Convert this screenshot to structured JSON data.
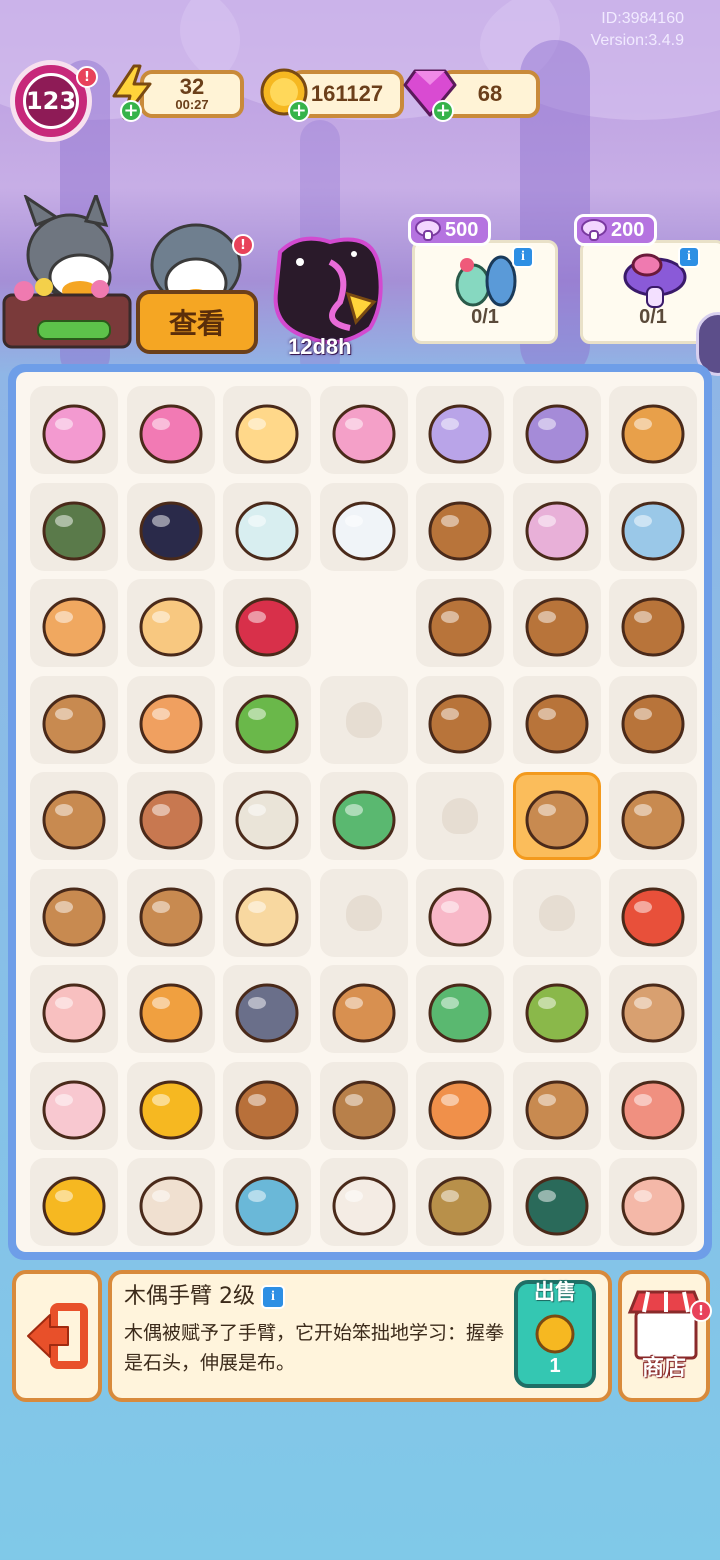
{
  "header": {
    "user_id": "ID:3984160",
    "version": "Version:3.4.9",
    "level": "123",
    "level_alert": "!"
  },
  "resources": {
    "energy": {
      "value": "32",
      "timer": "00:27",
      "icon": "lightning-icon"
    },
    "coins": {
      "value": "161127",
      "icon": "coin-icon"
    },
    "gems": {
      "value": "68",
      "icon": "gem-icon"
    }
  },
  "actions": {
    "view_button": "查看",
    "event_timer": "12d8h",
    "characters_alert": "!"
  },
  "quests": [
    {
      "cost": "500",
      "progress": "0/1",
      "icon": "mushroom-icon",
      "info": "i"
    },
    {
      "cost": "200",
      "progress": "0/1",
      "icon": "mushroom-icon",
      "info": "i"
    }
  ],
  "board": {
    "rows": [
      [
        "pink-cloud-sack",
        "duck-pink-dress",
        "duck-fairy",
        "duck-flower-fairy",
        "rose-plate",
        "duck-mirror",
        "duck-portrait"
      ],
      [
        "moss-scarecrow",
        "black-bird",
        "white-rose",
        "white-swan",
        "puppet-stage",
        "pink-smoke-bottle",
        "blue-gear-ring"
      ],
      [
        "orange-shawl",
        "sweet-pancake",
        "red-rose-face",
        "empty",
        "puppet-stage",
        "puppet-stage",
        "puppet-stage"
      ],
      [
        "wood-puppet",
        "fruit-pie",
        "green-lettuce",
        "ghost",
        "puppet-stage",
        "puppet-stage",
        "puppet-stage"
      ],
      [
        "wood-puppet",
        "picnic-basket",
        "paper-scroll",
        "four-leaf-clover",
        "ghost",
        "wood-arms",
        "wood-arm"
      ],
      [
        "wood-puppet",
        "wood-puppet",
        "cherry-cupcake",
        "ghost",
        "pink-bun",
        "ghost",
        "mushroom-stool"
      ],
      [
        "pig-cat-pile",
        "jam-cookies",
        "raccoon-bandit",
        "mushroom-hand",
        "clover-leaves",
        "mushroom-patch",
        "wood-logs"
      ],
      [
        "pig-pair",
        "coin-pile",
        "brown-mushrooms",
        "tree-stump",
        "orange-mushroom-bush",
        "stump-puppet",
        "ham-roll"
      ],
      [
        "coin-heap",
        "small-mushroom",
        "blue-slime",
        "white-mushroom",
        "mossy-log",
        "dark-tree",
        "cottage"
      ]
    ],
    "selected": "wood-arms"
  },
  "detail": {
    "title": "木偶手臂 2级",
    "description": "木偶被赋予了手臂，它开始笨拙地学习：握拳是石头，伸展是布。",
    "sell_label": "出售",
    "sell_price": "1",
    "shop_label": "商店",
    "shop_alert": "!"
  },
  "colors": {
    "board_border": "#6e9ee8",
    "selected_cell": "#fbbd5b",
    "panel_border": "#d88a3c",
    "sell_button": "#34c7b2"
  }
}
